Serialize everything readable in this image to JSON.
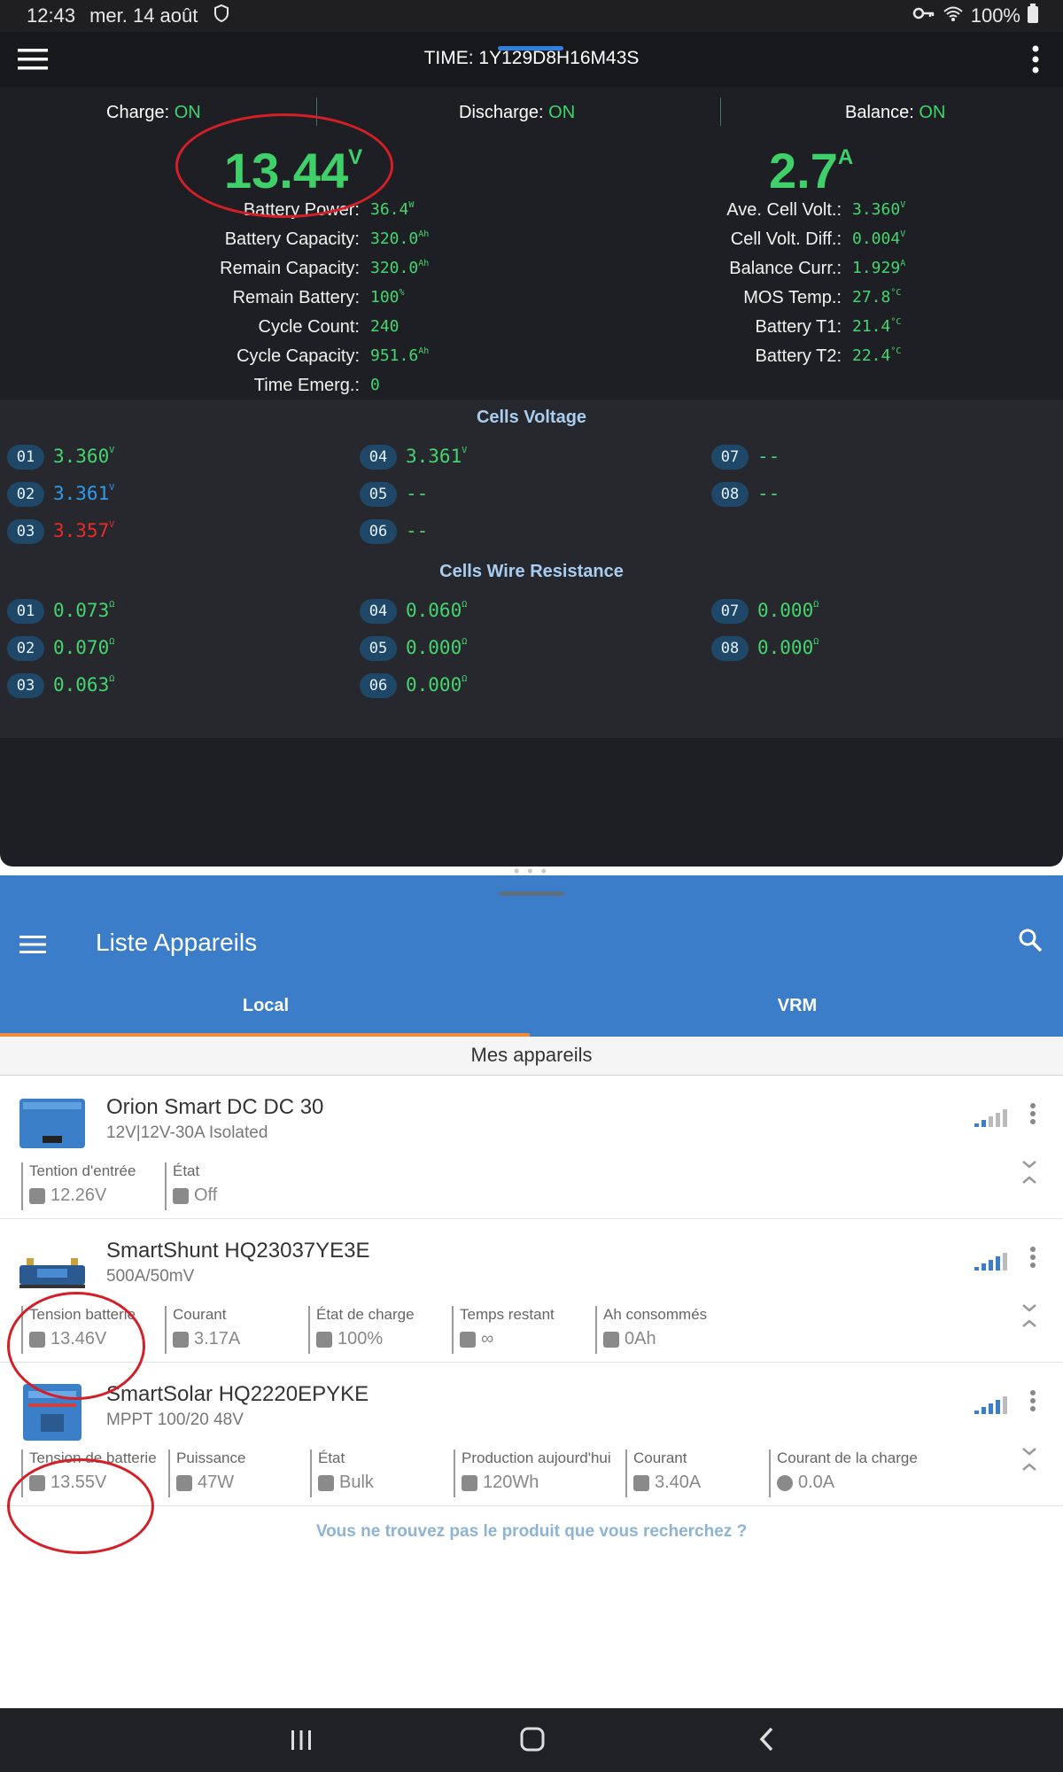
{
  "status_bar": {
    "time": "12:43",
    "date": "mer. 14 août",
    "battery": "100%"
  },
  "bms": {
    "header_title": "TIME: 1Y129D8H16M43S",
    "switches": [
      {
        "label": "Charge:",
        "state": "ON"
      },
      {
        "label": "Discharge:",
        "state": "ON"
      },
      {
        "label": "Balance:",
        "state": "ON"
      }
    ],
    "voltage": {
      "value": "13.44",
      "unit": "V"
    },
    "current": {
      "value": "2.7",
      "unit": "A"
    },
    "left_info": [
      {
        "label": "Battery Power:",
        "value": "36.4",
        "unit": "W"
      },
      {
        "label": "Battery Capacity:",
        "value": "320.0",
        "unit": "Ah"
      },
      {
        "label": "Remain Capacity:",
        "value": "320.0",
        "unit": "Ah"
      },
      {
        "label": "Remain Battery:",
        "value": "100",
        "unit": "%"
      },
      {
        "label": "Cycle Count:",
        "value": "240",
        "unit": ""
      },
      {
        "label": "Cycle Capacity:",
        "value": "951.6",
        "unit": "Ah"
      },
      {
        "label": "Time Emerg.:",
        "value": "0",
        "unit": ""
      }
    ],
    "right_info": [
      {
        "label": "Ave. Cell Volt.:",
        "value": "3.360",
        "unit": "V"
      },
      {
        "label": "Cell Volt. Diff.:",
        "value": "0.004",
        "unit": "V"
      },
      {
        "label": "Balance Curr.:",
        "value": "1.929",
        "unit": "A"
      },
      {
        "label": "MOS Temp.:",
        "value": "27.8",
        "unit": "°C"
      },
      {
        "label": "Battery T1:",
        "value": "21.4",
        "unit": "°C"
      },
      {
        "label": "Battery T2:",
        "value": "22.4",
        "unit": "°C"
      }
    ],
    "cells_voltage_title": "Cells Voltage",
    "cells_voltage": [
      {
        "id": "01",
        "value": "3.360",
        "unit": "V",
        "color": "#44d56e"
      },
      {
        "id": "02",
        "value": "3.361",
        "unit": "V",
        "color": "#2f9bef"
      },
      {
        "id": "03",
        "value": "3.357",
        "unit": "V",
        "color": "#ea2b2b"
      },
      {
        "id": "04",
        "value": "3.361",
        "unit": "V",
        "color": "#44d56e"
      },
      {
        "id": "05",
        "value": "--",
        "unit": "",
        "color": "#44d56e"
      },
      {
        "id": "06",
        "value": "--",
        "unit": "",
        "color": "#44d56e"
      },
      {
        "id": "07",
        "value": "--",
        "unit": "",
        "color": "#44d56e"
      },
      {
        "id": "08",
        "value": "--",
        "unit": "",
        "color": "#44d56e"
      }
    ],
    "cells_resistance_title": "Cells Wire Resistance",
    "cells_resistance": [
      {
        "id": "01",
        "value": "0.073",
        "unit": "Ω"
      },
      {
        "id": "02",
        "value": "0.070",
        "unit": "Ω"
      },
      {
        "id": "03",
        "value": "0.063",
        "unit": "Ω"
      },
      {
        "id": "04",
        "value": "0.060",
        "unit": "Ω"
      },
      {
        "id": "05",
        "value": "0.000",
        "unit": "Ω"
      },
      {
        "id": "06",
        "value": "0.000",
        "unit": "Ω"
      },
      {
        "id": "07",
        "value": "0.000",
        "unit": "Ω"
      },
      {
        "id": "08",
        "value": "0.000",
        "unit": "Ω"
      }
    ]
  },
  "victron": {
    "title": "Liste Appareils",
    "tabs": [
      "Local",
      "VRM"
    ],
    "subheader": "Mes appareils",
    "devices": [
      {
        "name": "Orion Smart DC DC 30",
        "subtitle": "12V|12V-30A Isolated",
        "metrics": [
          {
            "label": "Tention d'entrée",
            "value": "12.26V",
            "icon": "battery-icon"
          },
          {
            "label": "État",
            "value": "Off",
            "icon": "dots-icon"
          }
        ]
      },
      {
        "name": "SmartShunt HQ23037YE3E",
        "subtitle": "500A/50mV",
        "metrics": [
          {
            "label": "Tension batterie",
            "value": "13.46V",
            "icon": "battery-icon"
          },
          {
            "label": "Courant",
            "value": "3.17A",
            "icon": "gauge-icon"
          },
          {
            "label": "État de charge",
            "value": "100%",
            "icon": "battery-level-icon"
          },
          {
            "label": "Temps restant",
            "value": "∞",
            "icon": "timer-icon"
          },
          {
            "label": "Ah consommés",
            "value": "0Ah",
            "icon": "gauge-icon"
          }
        ]
      },
      {
        "name": "SmartSolar HQ2220EPYKE",
        "subtitle": "MPPT 100/20 48V",
        "metrics": [
          {
            "label": "Tension de batterie",
            "value": "13.55V",
            "icon": "battery-icon"
          },
          {
            "label": "Puissance",
            "value": "47W",
            "icon": "gauge-icon"
          },
          {
            "label": "État",
            "value": "Bulk",
            "icon": "dots-icon"
          },
          {
            "label": "Production aujourd'hui",
            "value": "120Wh",
            "icon": "gauge-icon"
          },
          {
            "label": "Courant",
            "value": "3.40A",
            "icon": "gauge-icon"
          },
          {
            "label": "Courant de la charge",
            "value": "0.0A",
            "icon": "bulb-icon"
          }
        ]
      }
    ],
    "not_found": "Vous ne trouvez pas le produit que vous recherchez ?"
  }
}
